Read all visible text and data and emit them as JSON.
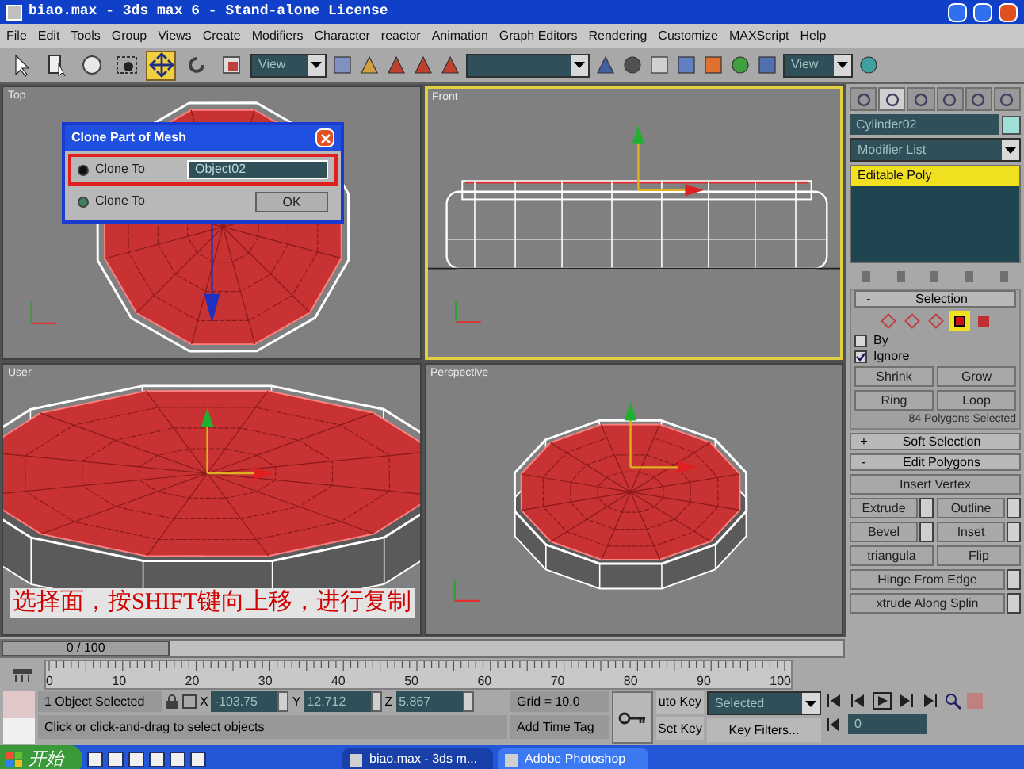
{
  "window": {
    "title": "biao.max - 3ds max 6 - Stand-alone License"
  },
  "menu": [
    "File",
    "Edit",
    "Tools",
    "Group",
    "Views",
    "Create",
    "Modifiers",
    "Character",
    "reactor",
    "Animation",
    "Graph Editors",
    "Rendering",
    "Customize",
    "MAXScript",
    "Help"
  ],
  "toolbar": {
    "tools": [
      {
        "selected": false
      },
      {
        "selected": false
      },
      {
        "selected": false
      },
      {
        "selected": false
      },
      {
        "selected": true
      },
      {
        "selected": false
      },
      {
        "selected": false
      }
    ],
    "coordinate_system": "View",
    "render_view": "View"
  },
  "viewports": [
    {
      "kind": "top",
      "label": "Top",
      "active": false
    },
    {
      "kind": "front",
      "label": "Front",
      "active": true
    },
    {
      "kind": "user",
      "label": "User",
      "active": false,
      "annotation": "选择面，按SHIFT键向上移，进行复制"
    },
    {
      "kind": "perspective",
      "label": "Perspective",
      "active": false
    }
  ],
  "dialog": {
    "title": "Clone Part of Mesh",
    "options": [
      {
        "kind": "field",
        "label": "Clone To",
        "selected": true,
        "highlighted": true,
        "value": "Object02"
      },
      {
        "kind": "button",
        "label": "Clone To",
        "selected": false,
        "highlighted": false,
        "button": "OK"
      }
    ]
  },
  "command_panel": {
    "tabs": [
      {
        "selected": false
      },
      {
        "selected": true
      },
      {
        "selected": false
      },
      {
        "selected": false
      },
      {
        "selected": false
      },
      {
        "selected": false
      }
    ],
    "object_name": "Cylinder02",
    "modifier_list": "Modifier List",
    "stack": [
      {
        "label": "Editable Poly",
        "selected": true
      }
    ],
    "selection": {
      "sign": "-",
      "title": "Selection",
      "levels": [
        {
          "selected": false
        },
        {
          "selected": false
        },
        {
          "selected": false
        },
        {
          "selected": true
        },
        {
          "selected": false
        }
      ],
      "checkboxes": [
        {
          "label": "By",
          "checked": false
        },
        {
          "label": "Ignore",
          "checked": true
        }
      ],
      "buttons": [
        "Shrink",
        "Grow",
        "Ring",
        "Loop"
      ],
      "status": "84 Polygons Selected"
    },
    "rollouts": [
      {
        "sign": "+",
        "title": "Soft Selection"
      },
      {
        "sign": "-",
        "title": "Edit Polygons"
      }
    ],
    "edit_polygons": [
      [
        {
          "label": "Insert Vertex",
          "settings": false
        }
      ],
      [
        {
          "label": "Extrude",
          "settings": true
        },
        {
          "label": "Outline",
          "settings": true
        }
      ],
      [
        {
          "label": "Bevel",
          "settings": true
        },
        {
          "label": "Inset",
          "settings": true
        }
      ],
      [
        {
          "label": "triangula",
          "settings": false
        },
        {
          "label": "Flip",
          "settings": false
        }
      ],
      [
        {
          "label": "Hinge From Edge",
          "settings": true
        }
      ],
      [
        {
          "label": "xtrude Along Splin",
          "settings": true
        }
      ]
    ]
  },
  "time_slider": {
    "label": "0 / 100",
    "level": 0
  },
  "trackbar": [
    "0",
    "10",
    "20",
    "30",
    "40",
    "50",
    "60",
    "70",
    "80",
    "90",
    "100"
  ],
  "status": {
    "selection": "1 Object Selected",
    "coordinates": [
      {
        "label": "X",
        "value": "-103.75"
      },
      {
        "label": "Y",
        "value": "12.712"
      },
      {
        "label": "Z",
        "value": "5.867"
      }
    ],
    "grid": "Grid = 10.0",
    "prompt": "Click or click-and-drag to select objects",
    "time_tag": "Add Time Tag",
    "auto_key": "uto Key",
    "set_key": "Set Key",
    "key_mode": "Selected",
    "key_filters": "Key Filters...",
    "frame": "0"
  },
  "taskbar": {
    "start": "开始",
    "tasks": [
      {
        "label": "biao.max - 3ds m...",
        "selected": true
      },
      {
        "label": "Adobe Photoshop",
        "selected": false
      }
    ]
  }
}
